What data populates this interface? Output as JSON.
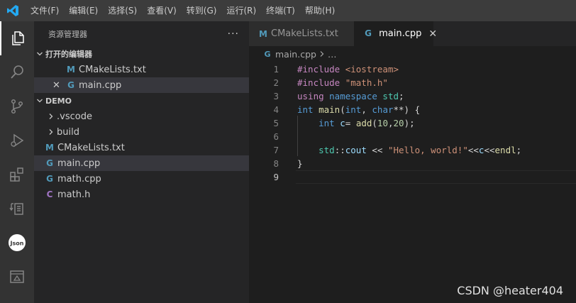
{
  "menu": [
    "文件(F)",
    "编辑(E)",
    "选择(S)",
    "查看(V)",
    "转到(G)",
    "运行(R)",
    "终端(T)",
    "帮助(H)"
  ],
  "sidebar": {
    "title": "资源管理器",
    "more": "···",
    "open_editors": {
      "label": "打开的编辑器",
      "items": [
        {
          "icon": "M",
          "name": "CMakeLists.txt"
        },
        {
          "icon": "G",
          "name": "main.cpp",
          "close": "✕"
        }
      ]
    },
    "folder": {
      "label": "DEMO",
      "items": [
        {
          "name": ".vscode"
        },
        {
          "name": "build"
        },
        {
          "icon": "M",
          "name": "CMakeLists.txt"
        },
        {
          "icon": "G",
          "name": "main.cpp"
        },
        {
          "icon": "G",
          "name": "math.cpp"
        },
        {
          "icon": "C",
          "name": "math.h"
        }
      ]
    }
  },
  "tabs": [
    {
      "icon": "M",
      "name": "CMakeLists.txt"
    },
    {
      "icon": "G",
      "name": "main.cpp",
      "close": "✕"
    }
  ],
  "breadcrumb": {
    "file": "main.cpp",
    "rest": "…"
  },
  "code": {
    "line_numbers": [
      "1",
      "2",
      "3",
      "4",
      "5",
      "6",
      "7",
      "8",
      "9"
    ],
    "l1": {
      "a": "#include ",
      "b": "<iostream>"
    },
    "l2": {
      "a": "#include ",
      "b": "\"math.h\""
    },
    "l3": {
      "a": "using ",
      "b": "namespace ",
      "c": "std",
      "d": ";"
    },
    "l4": {
      "a": "int ",
      "b": "main",
      "c": "(",
      "d": "int",
      "e": ", ",
      "f": "char",
      "g": "**) {"
    },
    "l5": {
      "a": "    ",
      "b": "int ",
      "c": "c",
      "d": "= ",
      "e": "add",
      "f": "(",
      "g": "10",
      "h": ",",
      "i": "20",
      "j": ");"
    },
    "l7": {
      "a": "    ",
      "b": "std",
      "c": "::",
      "d": "cout",
      "e": " << ",
      "f": "\"Hello, world!\"",
      "g": "<<",
      "h": "c",
      "i": "<<",
      "j": "endl",
      "k": ";"
    },
    "l8": {
      "a": "}"
    }
  },
  "watermark": "CSDN @heater404"
}
